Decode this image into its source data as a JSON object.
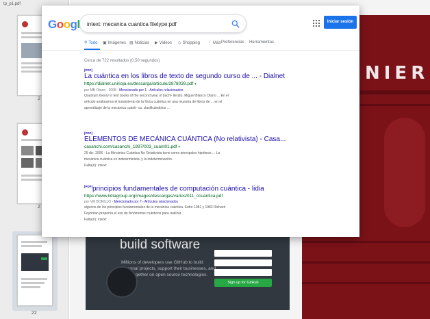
{
  "pdf_viewer": {
    "file_name": "tp_p1.pdf",
    "thumbnail_numbers": [
      "2",
      "2",
      "22"
    ],
    "red_page_text": "NIER",
    "github_banner": {
      "headline": "build software",
      "body": "Millions of developers use GitHub to build personal projects, support their businesses, and work together on open source technologies.",
      "signup_label": "Sign up for GitHub"
    }
  },
  "search": {
    "logo_letters": [
      "G",
      "o",
      "o",
      "g",
      "l",
      "e"
    ],
    "query": "intext: mecanica cuantica filetype:pdf",
    "apps_icon": "apps-grid-icon",
    "signin_label": "Iniciar sesión",
    "tabs": [
      {
        "label": "Todo",
        "icon": "search-icon",
        "active": true
      },
      {
        "label": "Imágenes",
        "icon": "image-icon",
        "active": false
      },
      {
        "label": "Noticias",
        "icon": "news-icon",
        "active": false
      },
      {
        "label": "Videos",
        "icon": "video-icon",
        "active": false
      },
      {
        "label": "Shopping",
        "icon": "tag-icon",
        "active": false
      },
      {
        "label": "Más",
        "icon": "more-icon",
        "active": false
      },
      {
        "label": "Preferencias",
        "icon": "",
        "active": false
      },
      {
        "label": "Herramientas",
        "icon": "",
        "active": false
      }
    ],
    "result_stats": "Cerca de 722 resultados (0,50 segundos)",
    "results": [
      {
        "tag": "[PDF]",
        "title": "La cuántica en los libros de texto de segundo curso de ... - Dialnet",
        "url": "https://dialnet.unirioja.es/descarga/articulo/2878039.pdf",
        "meta_prefix": "por MB Otano - 2008 - ",
        "meta_links": "Mencionado por 1 - Artículos relacionados",
        "snippet_1": "Quantum theory in text books of the second year of bachi- llerato. Miguel Blanco Otano ... En el",
        "snippet_2": "artículo analizamos el tratamiento de la física cuántica en una muestra de libros de ... en el",
        "snippet_3": "aprendizaje de la mecánica cuánti- ca, clasificándolos ..."
      },
      {
        "tag": "[PDF]",
        "title": "ELEMENTOS DE MECÁNICA CUÁNTICA (No relativista) - Casa...",
        "url": "casanchi.com/casanchi_1997/003_cuant01.pdf",
        "snippet_1": "29 dic. 2006 - La Mecánica Cuántica No Relativista tiene como principales hipótesis ... La",
        "snippet_2": "mecánica cuántica es indeterminista, y la indeterminación.",
        "missing": "Falta(n): intext:"
      },
      {
        "tag": "[PDF]",
        "title": "principios fundamentales de computación cuántica - lidia",
        "url": "https://www.lidiagroup.org/images/descargas/varios/011_ccuantica.pdf",
        "meta_prefix": "por VM BONILLO - ",
        "meta_links": "Mencionado por 7 - Artículos relacionados",
        "snippet_1": "algunos de los principios fundamentales de la mecánica cuántica. Entre 1981 y 1982 Richard",
        "snippet_2": "Feynman proponía el uso de fenómenos cuánticos para realizar.",
        "missing": "Falta(n): intext:"
      }
    ]
  }
}
